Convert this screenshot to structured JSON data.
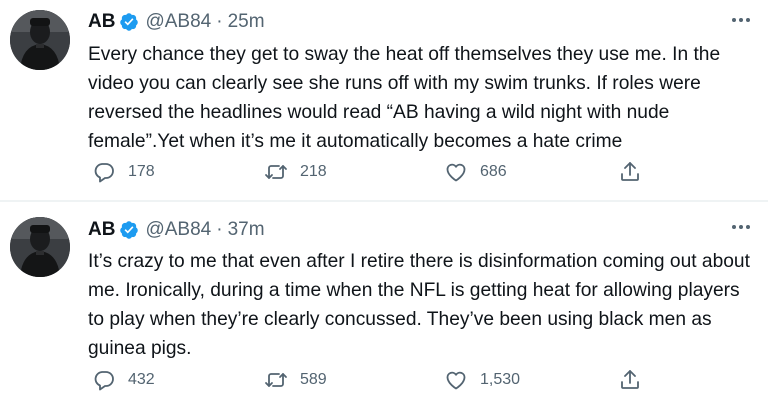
{
  "tweets": [
    {
      "name": "AB",
      "handle": "@AB84",
      "dot": "·",
      "time": "25m",
      "text": "Every chance they get to sway the heat off themselves they use me. In the video you can clearly see she runs off with my swim trunks. If roles were reversed the headlines would read “AB having a wild night with nude female”.Yet when it’s me it automatically becomes a hate crime",
      "replies": "178",
      "retweets": "218",
      "likes": "686"
    },
    {
      "name": "AB",
      "handle": "@AB84",
      "dot": "·",
      "time": "37m",
      "text": "It’s crazy to me that even after I retire there is disinformation coming out about me. Ironically, during a time when the NFL is getting heat for allowing players to play when they’re clearly concussed. They’ve been using black men as guinea pigs.",
      "replies": "432",
      "retweets": "589",
      "likes": "1,530"
    }
  ],
  "icons": {
    "verified": "verified-badge-icon",
    "more": "more-options-icon",
    "reply": "reply-icon",
    "retweet": "retweet-icon",
    "like": "heart-icon",
    "share": "share-icon"
  },
  "colors": {
    "text": "#0f1419",
    "secondary": "#536471",
    "verified": "#1d9bf0",
    "divider": "#eff3f4"
  }
}
